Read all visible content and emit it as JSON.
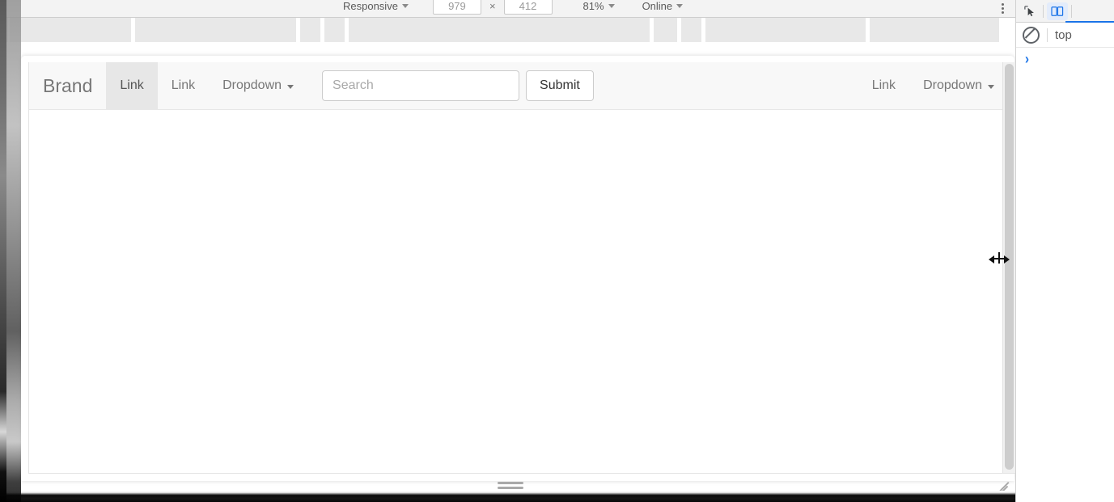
{
  "devtools": {
    "device_toolbar": {
      "device_mode": "Responsive",
      "width": "979",
      "height": "412",
      "zoom": "81%",
      "throttling": "Online",
      "more_options_icon": "kebab-menu-icon",
      "inspect_icon": "inspect-element-icon",
      "device_toggle_icon": "device-toolbar-toggle-icon"
    },
    "console": {
      "clear_icon": "clear-console-icon",
      "context": "top",
      "prompt_chevron": "›"
    }
  },
  "page": {
    "navbar": {
      "brand": "Brand",
      "left_items": [
        {
          "label": "Link",
          "type": "link",
          "active": true
        },
        {
          "label": "Link",
          "type": "link",
          "active": false
        },
        {
          "label": "Dropdown",
          "type": "dropdown",
          "active": false
        }
      ],
      "search": {
        "placeholder": "Search",
        "value": "",
        "submit_label": "Submit"
      },
      "right_items": [
        {
          "label": "Link",
          "type": "link"
        },
        {
          "label": "Dropdown",
          "type": "dropdown"
        }
      ]
    }
  },
  "colors": {
    "navbar_bg": "#f8f8f8",
    "navbar_active": "#e7e7e7",
    "navbar_text": "#777777",
    "accent_blue": "#1a73e8",
    "toolbar_bg": "#f3f3f3"
  }
}
